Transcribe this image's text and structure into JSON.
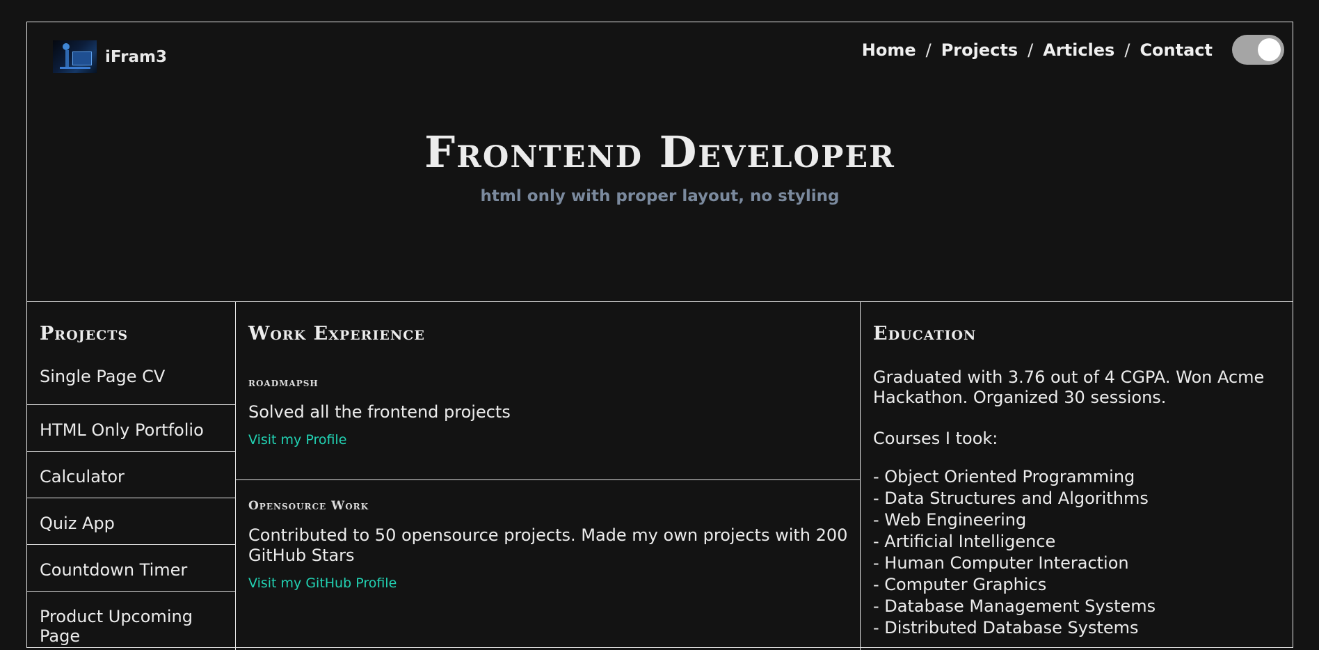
{
  "header": {
    "brand_name": "iFram3",
    "nav": [
      "Home",
      "Projects",
      "Articles",
      "Contact"
    ],
    "nav_separator": "/",
    "theme_toggle": "on"
  },
  "hero": {
    "title": "Frontend Developer",
    "subtitle": "html only with proper layout, no styling"
  },
  "projects": {
    "title": "Projects",
    "items": [
      "Single Page CV",
      "HTML Only Portfolio",
      "Calculator",
      "Quiz App",
      "Countdown Timer",
      "Product Upcoming Page"
    ]
  },
  "work": {
    "title": "Work Experience",
    "entries": [
      {
        "tag": "roadmapsh",
        "desc": "Solved all the frontend projects",
        "link": "Visit my Profile"
      },
      {
        "tag": "Opensource Work",
        "desc": "Contributed to 50 opensource projects. Made my own projects with 200 GitHub Stars",
        "link": "Visit my GitHub Profile"
      }
    ]
  },
  "education": {
    "title": "Education",
    "summary": "Graduated with 3.76 out of 4 CGPA. Won Acme Hackathon. Organized 30 sessions.",
    "courses_label": "Courses I took:",
    "courses": [
      "- Object Oriented Programming",
      "- Data Structures and Algorithms",
      "- Web Engineering",
      "- Artificial Intelligence",
      "- Human Computer Interaction",
      "- Computer Graphics",
      "- Database Management Systems",
      "- Distributed Database Systems"
    ]
  },
  "colors": {
    "background": "#131313",
    "text": "#e8e8e8",
    "subtitle": "#7b8a9e",
    "link": "#22d3b4",
    "toggle_track": "#a5a5a5"
  }
}
